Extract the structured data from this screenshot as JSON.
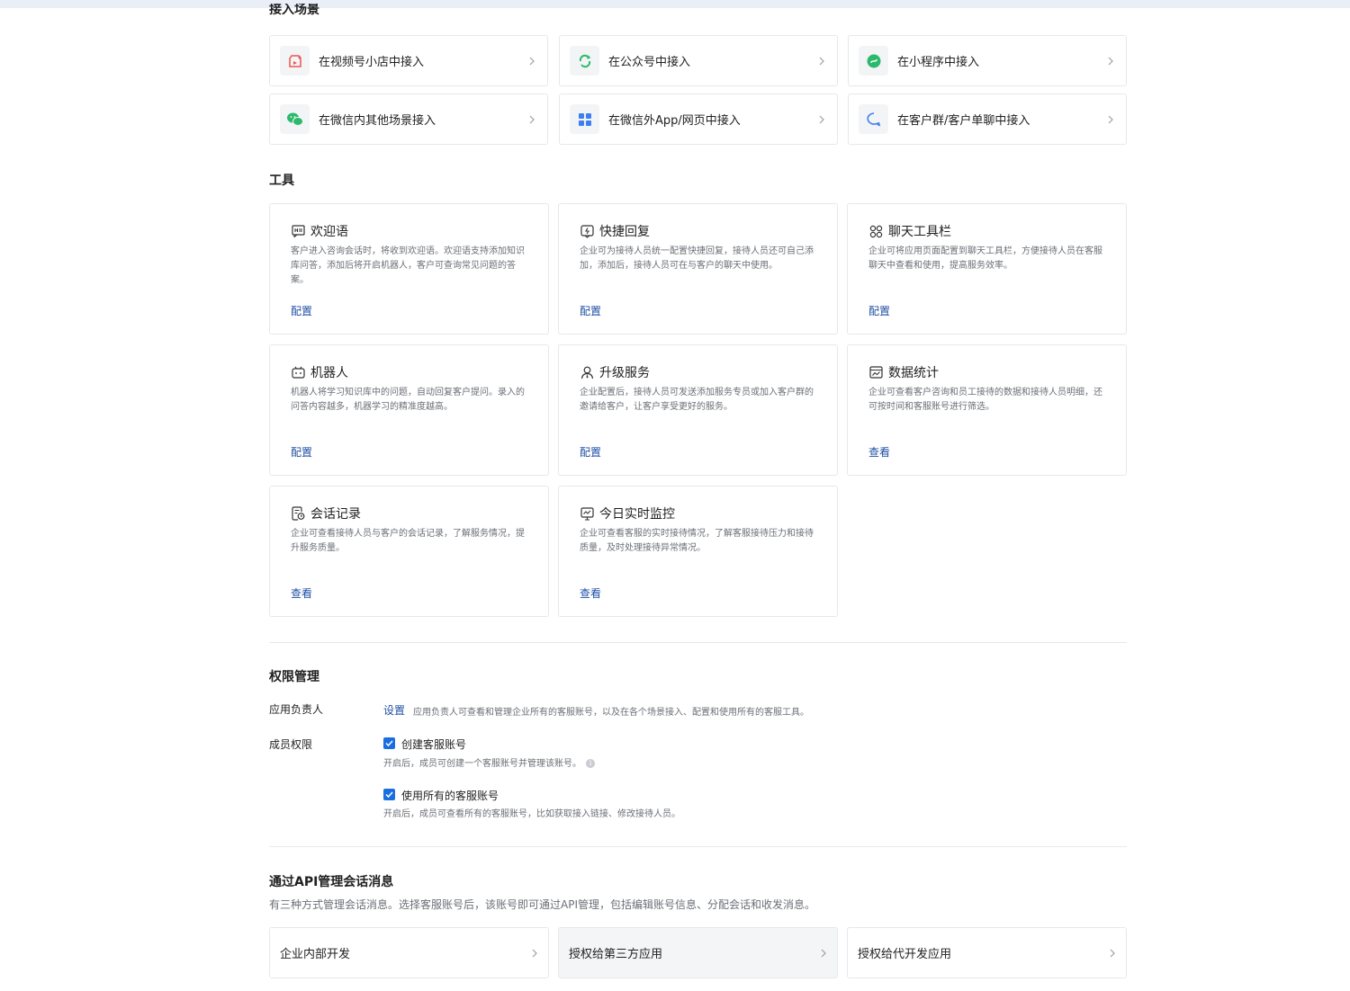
{
  "sections": {
    "scenes_title": "接入场景",
    "tools_title": "工具",
    "permission_title": "权限管理",
    "api_title": "通过API管理会话消息"
  },
  "scenes": [
    {
      "label": "在视频号小店中接入",
      "icon": "shop-video-icon",
      "color": "#f0544f"
    },
    {
      "label": "在公众号中接入",
      "icon": "official-account-icon",
      "color": "#2bba6b"
    },
    {
      "label": "在小程序中接入",
      "icon": "mini-program-icon",
      "color": "#2bba6b"
    },
    {
      "label": "在微信内其他场景接入",
      "icon": "wechat-icon",
      "color": "#2bba6b"
    },
    {
      "label": "在微信外App/网页中接入",
      "icon": "app-grid-icon",
      "color": "#3d7ff0"
    },
    {
      "label": "在客户群/客户单聊中接入",
      "icon": "chat-bubble-icon",
      "color": "#3d7ff0"
    }
  ],
  "tools": [
    {
      "title": "欢迎语",
      "icon": "welcome-message-icon",
      "desc": "客户进入咨询会话时，将收到欢迎语。欢迎语支持添加知识库问答，添加后将开启机器人，客户可查询常见问题的答案。",
      "action": "配置"
    },
    {
      "title": "快捷回复",
      "icon": "quick-reply-icon",
      "desc": "企业可为接待人员统一配置快捷回复，接待人员还可自己添加，添加后，接待人员可在与客户的聊天中使用。",
      "action": "配置"
    },
    {
      "title": "聊天工具栏",
      "icon": "toolbar-icon",
      "desc": "企业可将应用页面配置到聊天工具栏，方便接待人员在客服聊天中查看和使用，提高服务效率。",
      "action": "配置"
    },
    {
      "title": "机器人",
      "icon": "robot-icon",
      "desc": "机器人将学习知识库中的问题，自动回复客户提问。录入的问答内容越多，机器学习的精准度越高。",
      "action": "配置"
    },
    {
      "title": "升级服务",
      "icon": "upgrade-service-icon",
      "desc": "企业配置后，接待人员可发送添加服务专员或加入客户群的邀请给客户，让客户享受更好的服务。",
      "action": "配置"
    },
    {
      "title": "数据统计",
      "icon": "data-stats-icon",
      "desc": "企业可查看客户咨询和员工接待的数据和接待人员明细，还可按时间和客服账号进行筛选。",
      "action": "查看"
    },
    {
      "title": "会话记录",
      "icon": "session-record-icon",
      "desc": "企业可查看接待人员与客户的会话记录，了解服务情况，提升服务质量。",
      "action": "查看"
    },
    {
      "title": "今日实时监控",
      "icon": "realtime-monitor-icon",
      "desc": "企业可查看客服的实时接待情况，了解客服接待压力和接待质量，及时处理接待异常情况。",
      "action": "查看"
    }
  ],
  "permission": {
    "owner_label": "应用负责人",
    "owner_action": "设置",
    "owner_desc": "应用负责人可查看和管理企业所有的客服账号，以及在各个场景接入、配置和使用所有的客服工具。",
    "member_label": "成员权限",
    "options": [
      {
        "label": "创建客服账号",
        "checked": true,
        "desc": "开启后，成员可创建一个客服账号并管理该账号。"
      },
      {
        "label": "使用所有的客服账号",
        "checked": true,
        "desc": "开启后，成员可查看所有的客服账号，比如获取接入链接、修改接待人员。"
      }
    ]
  },
  "api": {
    "desc": "有三种方式管理会话消息。选择客服账号后，该账号即可通过API管理，包括编辑账号信息、分配会话和收发消息。",
    "options": [
      {
        "label": "企业内部开发"
      },
      {
        "label": "授权给第三方应用"
      },
      {
        "label": "授权给代开发应用"
      }
    ]
  },
  "colors": {
    "link": "#1f4fa5",
    "checkbox": "#1a6fe0",
    "border": "#e6e8eb"
  }
}
